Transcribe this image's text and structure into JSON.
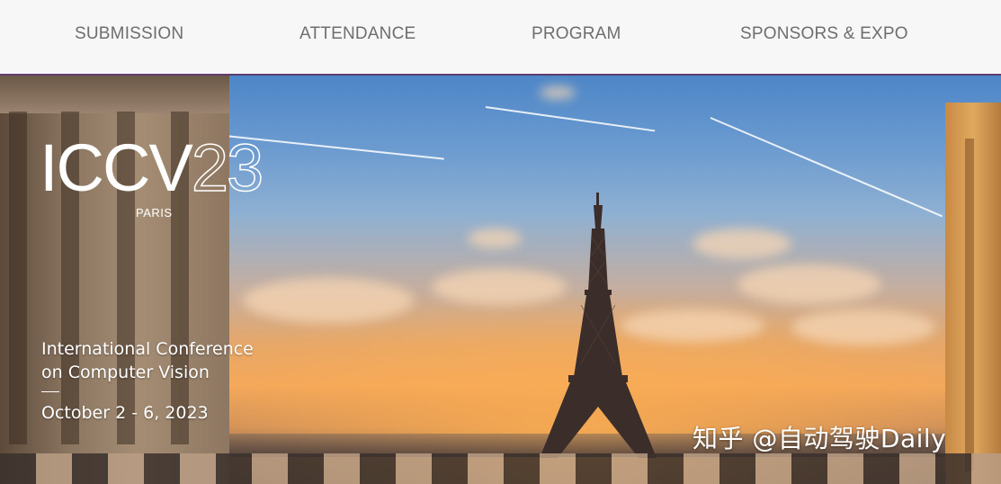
{
  "nav": {
    "items": [
      {
        "label": "SUBMISSION"
      },
      {
        "label": "ATTENDANCE"
      },
      {
        "label": "PROGRAM"
      },
      {
        "label": "SPONSORS & EXPO"
      }
    ]
  },
  "hero": {
    "logo_main": "ICCV",
    "logo_year": "23",
    "logo_city": "PARIS",
    "conference_line1": "International Conference",
    "conference_line2": "on Computer Vision",
    "date": "October 2 - 6, 2023",
    "background_image": "eiffel-tower-sunset-photo"
  },
  "watermark": {
    "text": "知乎 @自动驾驶Daily"
  },
  "colors": {
    "nav_bg": "#f7f7f7",
    "nav_text": "#6e6e6e",
    "nav_border": "#5e3c6e",
    "hero_text": "#ffffff"
  }
}
